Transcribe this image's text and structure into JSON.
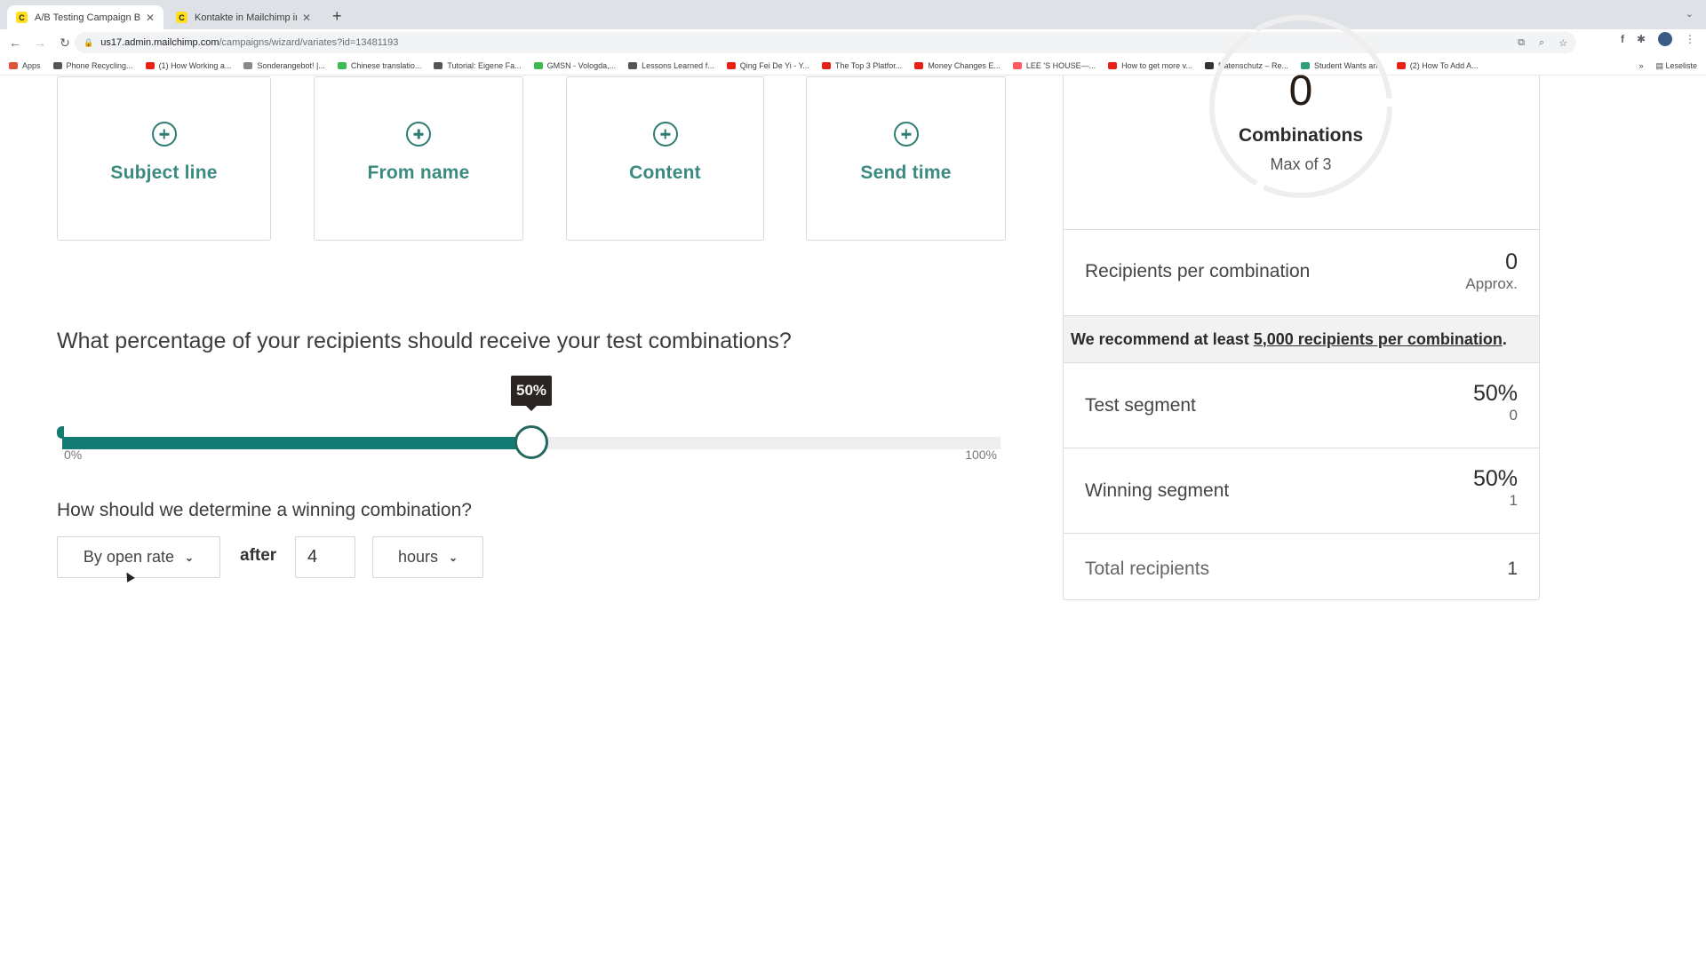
{
  "browser": {
    "tabs": [
      {
        "title": "A/B Testing Campaign Builder",
        "active": true
      },
      {
        "title": "Kontakte in Mailchimp importie",
        "active": false
      }
    ],
    "url_host": "us17.admin.mailchimp.com",
    "url_path": "/campaigns/wizard/variates?id=13481193",
    "bookmarks": [
      {
        "label": "Apps",
        "color": "#e0533d"
      },
      {
        "label": "Phone Recycling...",
        "color": "#555555"
      },
      {
        "label": "(1) How Working a...",
        "color": "#e62117"
      },
      {
        "label": "Sonderangebot! |...",
        "color": "#888888"
      },
      {
        "label": "Chinese translatio...",
        "color": "#3cba54"
      },
      {
        "label": "Tutorial: Eigene Fa...",
        "color": "#555555"
      },
      {
        "label": "GMSN - Vologda,...",
        "color": "#3cba54"
      },
      {
        "label": "Lessons Learned f...",
        "color": "#555555"
      },
      {
        "label": "Qing Fei De Yi - Y...",
        "color": "#e62117"
      },
      {
        "label": "The Top 3 Platfor...",
        "color": "#e62117"
      },
      {
        "label": "Money Changes E...",
        "color": "#e62117"
      },
      {
        "label": "LEE 'S HOUSE—...",
        "color": "#ff5a5f"
      },
      {
        "label": "How to get more v...",
        "color": "#e62117"
      },
      {
        "label": "Datenschutz – Re...",
        "color": "#333333"
      },
      {
        "label": "Student Wants an...",
        "color": "#2f9e7a"
      },
      {
        "label": "(2) How To Add A...",
        "color": "#e62117"
      }
    ],
    "bookmarks_overflow": "»",
    "reading_list": "Leseliste"
  },
  "variables": {
    "cards": [
      {
        "label": "Subject line",
        "icon": "plus-circle-icon"
      },
      {
        "label": "From name",
        "icon": "plus-circle-icon"
      },
      {
        "label": "Content",
        "icon": "plus-circle-icon"
      },
      {
        "label": "Send time",
        "icon": "plus-circle-icon"
      }
    ]
  },
  "test_percentage": {
    "question": "What percentage of your recipients should receive your test combinations?",
    "value_percent": 50,
    "tooltip": "50%",
    "min_label": "0%",
    "max_label": "100%"
  },
  "winner": {
    "question": "How should we determine a winning combination?",
    "metric_selected": "By open rate",
    "after_label": "after",
    "duration_value": "4",
    "unit_selected": "hours"
  },
  "summary": {
    "combinations_count": "0",
    "combinations_label": "Combinations",
    "combinations_max": "Max of 3",
    "recipients_per_combination": {
      "label": "Recipients per combination",
      "value": "0",
      "note": "Approx."
    },
    "recommend_text": "We recommend at least",
    "recommend_link": "5,000 recipients per combination",
    "recommend_end": ".",
    "test_segment": {
      "label": "Test segment",
      "percent": "50%",
      "count": "0"
    },
    "winning_segment": {
      "label": "Winning segment",
      "percent": "50%",
      "count": "1"
    },
    "total_recipients": {
      "label": "Total recipients",
      "value": "1"
    }
  },
  "colors": {
    "accent": "#147b73",
    "card_text": "#3a8a80",
    "tooltip_bg": "#2a2423"
  }
}
